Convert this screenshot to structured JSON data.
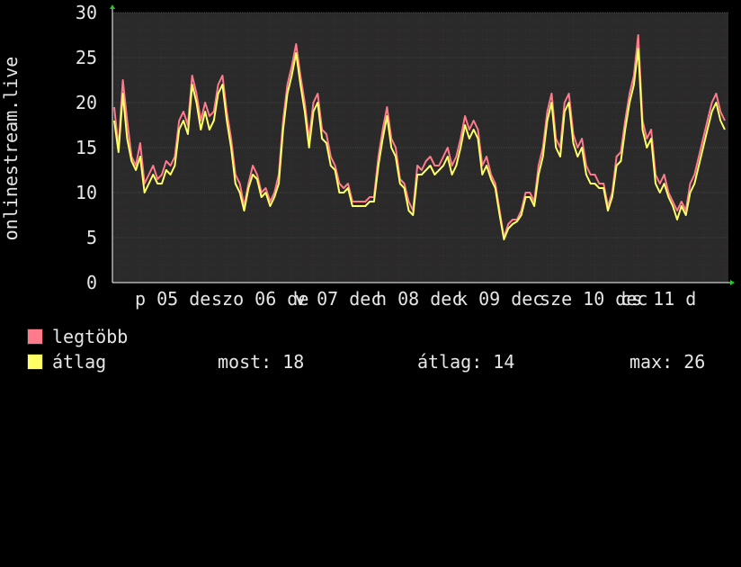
{
  "chart_data": {
    "type": "line",
    "ylabel": "onlinestream.live",
    "ylim": [
      0,
      30
    ],
    "yticks": [
      0,
      5,
      10,
      15,
      20,
      25,
      30
    ],
    "x_tick_labels": [
      "p 05 de",
      "szo 06 de",
      "v 07 dec",
      "h 08 dec",
      "k 09 dec",
      "sze 10 dec",
      "cs 11 d"
    ],
    "grid": true,
    "colors": {
      "background": "#000000",
      "plot_background": "#2a2a2a",
      "grid": "#5a3a3a",
      "axis": "#ffffff",
      "text": "#e6e6e6",
      "legtobb": "#ff7b8c",
      "atlag": "#ffff66"
    },
    "series": [
      {
        "name": "legtöbb",
        "color": "#ff7b8c",
        "values": [
          19.5,
          15,
          22.5,
          18,
          14,
          13,
          15.5,
          11,
          12,
          13,
          11.5,
          12,
          13.5,
          13,
          14,
          18,
          19,
          17.5,
          23,
          21,
          18,
          20,
          18.5,
          19,
          22,
          23,
          19,
          16,
          12,
          11,
          8.5,
          11,
          13,
          12,
          10,
          10.5,
          9,
          10,
          12,
          18,
          22,
          24,
          26.5,
          23,
          20,
          16,
          20,
          21,
          17,
          16.5,
          14,
          13,
          11,
          10.5,
          11,
          9,
          9,
          9,
          9,
          9.5,
          9.5,
          14,
          17,
          19.5,
          16,
          15,
          11.5,
          11,
          9,
          8,
          13,
          12.5,
          13.5,
          14,
          13,
          13,
          14,
          15,
          13,
          14,
          16,
          18.5,
          17,
          18,
          17,
          13,
          14,
          12,
          11,
          8,
          5,
          6.5,
          7,
          7,
          8,
          10,
          10,
          9,
          13,
          15,
          19,
          21,
          16,
          15,
          20,
          21,
          16.5,
          15,
          16,
          13,
          12,
          12,
          11,
          11,
          8.5,
          10,
          14,
          14.5,
          18,
          21,
          23,
          27.5,
          18,
          16,
          17,
          12,
          11,
          12,
          10,
          9,
          8,
          9,
          8,
          11,
          12,
          14,
          16,
          18,
          20,
          21,
          19,
          18
        ]
      },
      {
        "name": "átlag",
        "color": "#ffff66",
        "values": [
          18,
          14.5,
          21,
          16,
          13.5,
          12.5,
          14,
          10,
          11,
          12,
          11,
          11,
          12.5,
          12,
          13,
          17,
          18,
          16.5,
          22,
          20,
          17,
          19,
          17,
          18,
          21,
          22,
          18,
          15,
          11,
          10,
          8,
          10.5,
          12,
          11.5,
          9.5,
          10,
          8.5,
          9.5,
          11,
          17,
          21,
          23,
          25.5,
          22,
          19,
          15,
          19,
          20,
          16,
          15.5,
          13,
          12.5,
          10,
          10,
          10.5,
          8.5,
          8.5,
          8.5,
          8.5,
          9,
          9,
          13,
          16,
          18.5,
          15,
          14,
          11,
          10.5,
          8,
          7.5,
          12,
          12,
          12.5,
          13,
          12,
          12.5,
          13,
          14,
          12,
          13,
          15,
          17.5,
          16,
          17,
          16,
          12,
          13,
          11.5,
          10.5,
          7.5,
          4.8,
          6,
          6.5,
          6.8,
          7.5,
          9.5,
          9.5,
          8.5,
          12,
          14,
          18,
          20,
          15,
          14,
          19,
          20,
          15.5,
          14,
          15,
          12,
          11,
          11,
          10.5,
          10.5,
          8,
          9.5,
          13,
          13.5,
          17,
          20,
          22,
          26,
          17,
          15,
          16,
          11,
          10,
          11,
          9.5,
          8.5,
          7,
          8.5,
          7.5,
          10,
          11,
          13,
          15,
          17,
          19,
          20,
          18,
          17
        ]
      }
    ],
    "stats": {
      "most": {
        "label": "most:",
        "value": "18"
      },
      "atlag": {
        "label": "átlag:",
        "value": "14"
      },
      "max": {
        "label": "max:",
        "value": "26"
      }
    }
  }
}
